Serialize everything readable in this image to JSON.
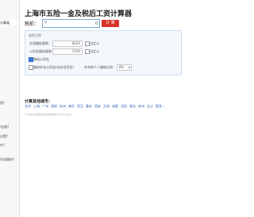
{
  "sidebar": {
    "items": [
      {
        "label": "计算器",
        "active": true
      },
      {
        "label": "税?",
        "active": false
      },
      {
        "label": "l金缴?",
        "active": false
      },
      {
        "label": "设置?",
        "active": false
      },
      {
        "label": "何?",
        "active": false
      },
      {
        "label": "社保缴纳?",
        "active": false
      }
    ]
  },
  "page": {
    "title": "上海市五险一金及税后工资计算器"
  },
  "tax": {
    "label": "税前：",
    "currency": "¥",
    "value": "0",
    "button": "计 算"
  },
  "settings": {
    "legend": "缴费设置",
    "social_base_label": "社保缴纳基数：",
    "social_base_value": "8020",
    "fund_base_label": "公积金缴纳基数：",
    "fund_base_value": "2590",
    "custom_label_1": "自定义",
    "custom_label_2": "自定义",
    "fund_label": "缴纳公积金",
    "supplement_label": "缴纳补充公积金(非必须项目)",
    "supplement_rate_label": "补充每个人缴纳比例：",
    "supplement_rate_value": "8%"
  },
  "cities": {
    "title": "计算其他城市：",
    "list": [
      "北京",
      "上海",
      "广州",
      "深圳",
      "杭州",
      "南京",
      "武汉",
      "重庆",
      "西安",
      "天津",
      "成都",
      "沈阳",
      "青岛",
      "苏州",
      "长沙",
      "更多..."
    ]
  },
  "footer": {
    "note": "广东省社会保险基金管理局统计与Shanghai"
  }
}
